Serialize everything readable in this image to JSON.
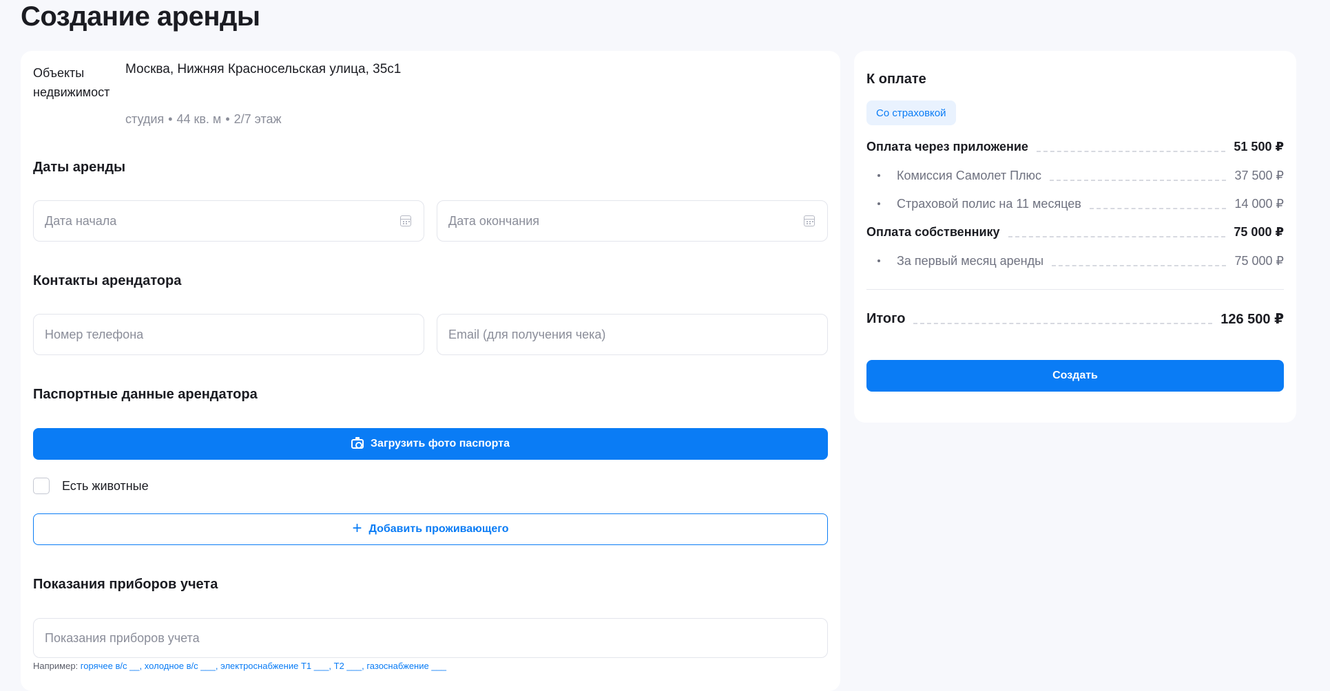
{
  "page_title": "Создание аренды",
  "property": {
    "image_alt": "Объекты недвижимост",
    "address": "Москва, Нижняя Красносельская улица, 35с1",
    "type": "студия",
    "area": "44 кв. м",
    "floor": "2/7 этаж"
  },
  "rental_dates": {
    "title": "Даты аренды",
    "start_placeholder": "Дата начала",
    "end_placeholder": "Дата окончания"
  },
  "contacts": {
    "title": "Контакты арендатора",
    "phone_placeholder": "Номер телефона",
    "email_placeholder": "Email (для получения чека)"
  },
  "passport": {
    "title": "Паспортные данные арендатора",
    "upload_label": "Загрузить фото паспорта",
    "pets_label": "Есть животные",
    "add_resident_label": "Добавить проживающего"
  },
  "meters": {
    "title": "Показания приборов учета",
    "placeholder": "Показания приборов учета",
    "hint_prefix": "Например:",
    "hint_example": "горячее в/с __, холодное в/с ___, электроснабжение Т1 ___, Т2 ___, газоснабжение ___"
  },
  "payment": {
    "title": "К оплате",
    "badge": "Со страховкой",
    "app_label": "Оплата через приложение",
    "app_value": "51 500 ₽",
    "commission_label": "Комиссия Самолет Плюс",
    "commission_value": "37 500 ₽",
    "insurance_label": "Страховой полис на 11 месяцев",
    "insurance_value": "14 000 ₽",
    "owner_label": "Оплата собственнику",
    "owner_value": "75 000 ₽",
    "first_month_label": "За первый месяц аренды",
    "first_month_value": "75 000 ₽",
    "total_label": "Итого",
    "total_value": "126 500 ₽",
    "create_label": "Создать"
  },
  "colors": {
    "accent": "#0a7cf5",
    "background": "#f7f8fc",
    "badge_bg": "#e9f2fe"
  }
}
